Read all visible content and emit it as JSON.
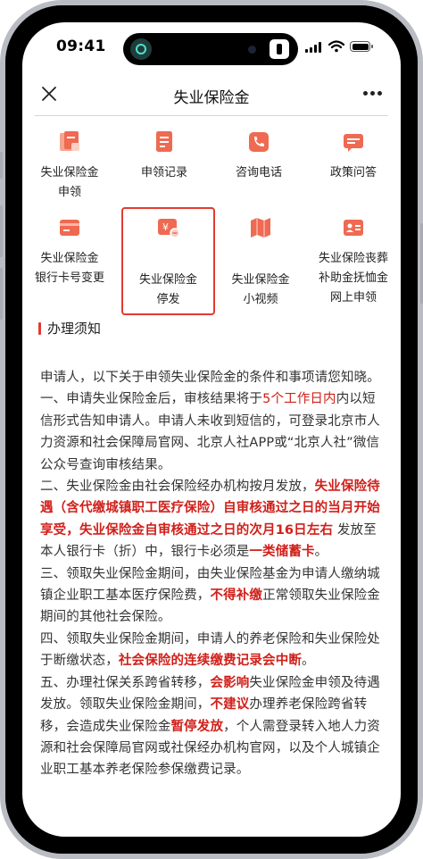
{
  "status": {
    "time": "09:41",
    "icons": [
      "airplay-icon",
      "camera-icon",
      "signal-icon",
      "wifi-icon",
      "battery-icon"
    ]
  },
  "nav": {
    "title": "失业保险金",
    "close_icon": "close-icon",
    "more_icon": "more-icon"
  },
  "grid": [
    {
      "id": "apply",
      "label": "失业保险金\n申领",
      "icon": "document-icon"
    },
    {
      "id": "records",
      "label": "申领记录",
      "icon": "record-icon"
    },
    {
      "id": "phone",
      "label": "咨询电话",
      "icon": "phone-icon"
    },
    {
      "id": "policy",
      "label": "政策问答",
      "icon": "chat-icon"
    },
    {
      "id": "bankcard",
      "label": "失业保险金\n银行卡号变更",
      "icon": "card-icon"
    },
    {
      "id": "suspend",
      "label": "失业保险金\n停发",
      "icon": "yuan-stop-icon"
    },
    {
      "id": "video",
      "label": "失业保险金\n小视频",
      "icon": "map-video-icon"
    },
    {
      "id": "funeral",
      "label": "失业保险丧葬\n补助金抚恤金\n网上申领",
      "icon": "id-card-icon"
    }
  ],
  "accent_color": "#e23b2f",
  "section": {
    "title": "办理须知"
  },
  "notice": {
    "intro": "申请人，以下关于申领失业保险金的条件和事项请您知晓。",
    "p1": [
      "一、申请失业保险金后，审核结果将于",
      "5个工作日内",
      "内以短信形式告知申请人。申请人未收到短信的，可登录北京市人力资源和社会保障局官网、北京人社APP或“北京人社”微信公众号查询审核结果。"
    ],
    "p2": [
      "二、失业保险金由社会保险经办机构按月发放，",
      "失业保险待遇（含代缴城镇职工医疗保险）自审核通过之日的当月开始享受，失业保险金自审核通过之日的次月16日左右",
      " 发放至本人银行卡（折）中，银行卡必须是",
      "一类储蓄卡",
      "。"
    ],
    "p3": [
      "三、领取失业保险金期间，由失业保险基金为申请人缴纳城镇企业职工基本医疗保险费，",
      "不得补缴",
      "正常领取失业保险金期间的其他社会保险。"
    ],
    "p4": [
      "四、领取失业保险金期间，申请人的养老保险和失业保险处于断缴状态，",
      "社会保险的连续缴费记录会中断",
      "。"
    ],
    "p5": [
      "五、办理社保关系跨省转移，",
      "会影响",
      "失业保险金申领及待遇发放。领取失业保险金期间，",
      "不建议",
      "办理养老保险跨省转移，会造成失业保险金",
      "暂停发放",
      "，个人需登录转入地人力资源和社会保障局官网或社保经办机构官网，",
      "",
      "以及个人城镇企业职工基本养老保险参保缴费记录。"
    ]
  }
}
